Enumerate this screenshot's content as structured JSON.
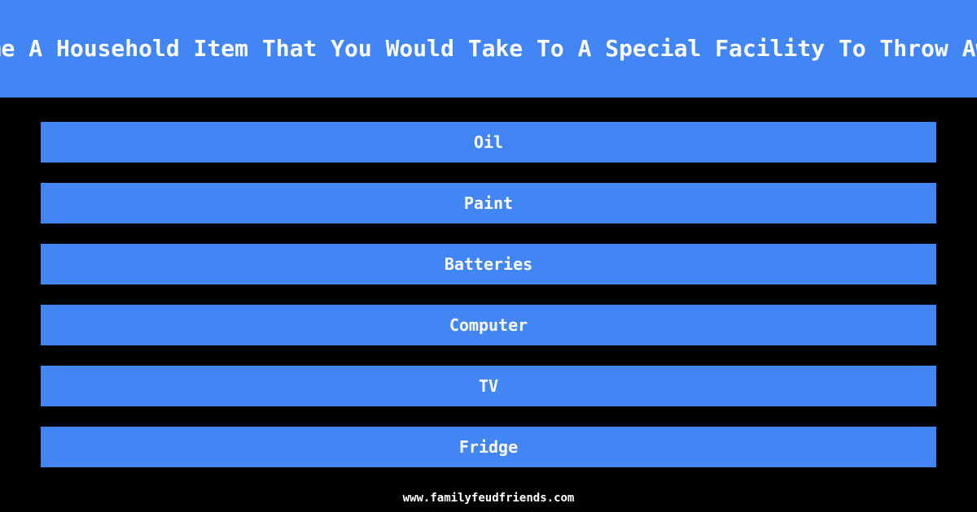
{
  "theme": {
    "background_color": "#000000",
    "accent_color": "#4285f4",
    "text_color": "#ffffff"
  },
  "header": {
    "question": "Name A Household Item That You Would Take To A Special Facility To Throw Away"
  },
  "answers": [
    {
      "label": "Oil"
    },
    {
      "label": "Paint"
    },
    {
      "label": "Batteries"
    },
    {
      "label": "Computer"
    },
    {
      "label": "TV"
    },
    {
      "label": "Fridge"
    }
  ],
  "footer": {
    "url": "www.familyfeudfriends.com"
  }
}
